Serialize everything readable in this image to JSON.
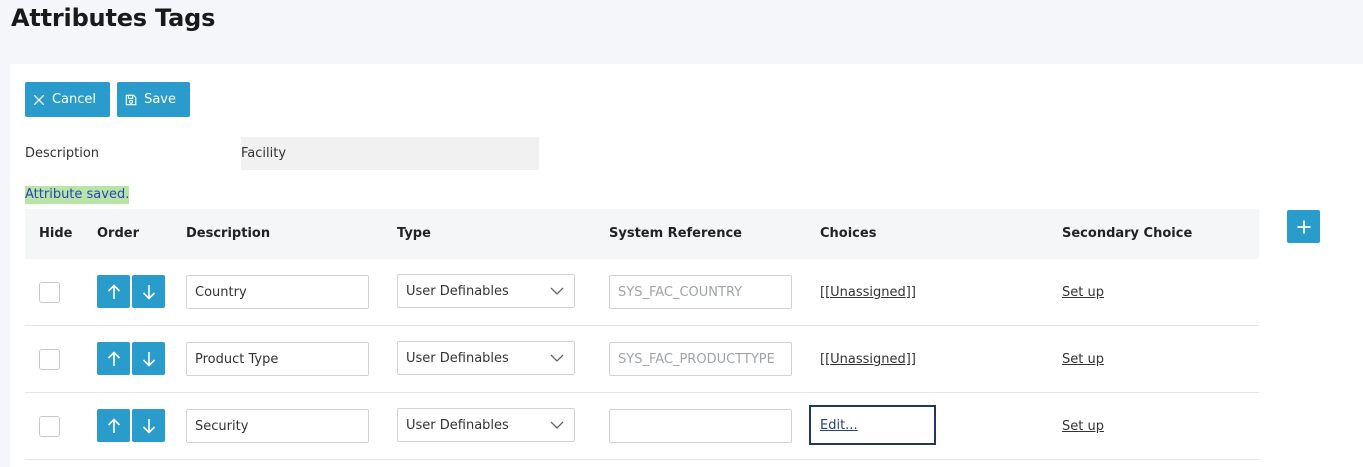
{
  "page": {
    "title": "Attributes Tags"
  },
  "toolbar": {
    "cancel_label": "Cancel",
    "save_label": "Save"
  },
  "form": {
    "description_label": "Description",
    "description_value": "Facility"
  },
  "status": {
    "message": "Attribute saved."
  },
  "table": {
    "headers": {
      "hide": "Hide",
      "order": "Order",
      "description": "Description",
      "type": "Type",
      "system_reference": "System Reference",
      "choices": "Choices",
      "secondary_choice": "Secondary Choice"
    },
    "rows": [
      {
        "hidden": false,
        "description": "Country",
        "type": "User Definables",
        "system_reference": "SYS_FAC_COUNTRY",
        "choices": "[[Unassigned]]",
        "secondary_choice": "Set up"
      },
      {
        "hidden": false,
        "description": "Product Type",
        "type": "User Definables",
        "system_reference": "SYS_FAC_PRODUCTTYPE",
        "choices": "[[Unassigned]]",
        "secondary_choice": "Set up"
      },
      {
        "hidden": false,
        "description": "Security",
        "type": "User Definables",
        "system_reference": "",
        "choices": "Edit...",
        "secondary_choice": "Set up"
      }
    ]
  },
  "icons": {
    "cancel": "close-icon",
    "save": "floppy-disk-icon",
    "add": "plus-icon",
    "move_up": "arrow-up-icon",
    "move_down": "arrow-down-icon",
    "dropdown": "chevron-down-icon"
  },
  "colors": {
    "accent": "#2a9ccc",
    "status_bg": "#b8e4a8",
    "status_text": "#2a45b0"
  }
}
